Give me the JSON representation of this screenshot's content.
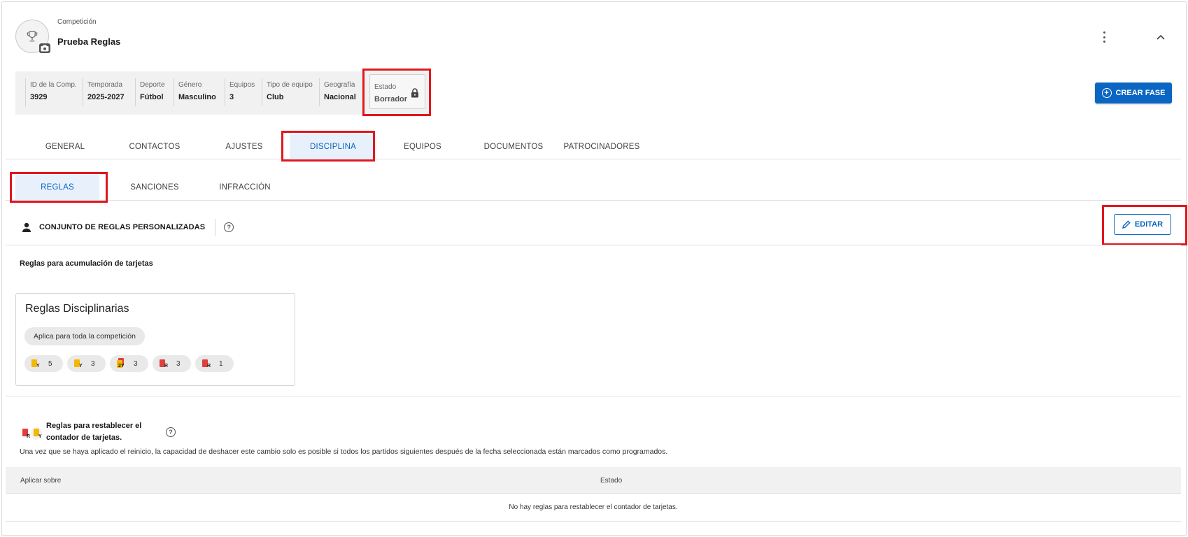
{
  "competition": {
    "label": "Competición",
    "name": "Prueba Reglas"
  },
  "info": [
    {
      "label": "ID de la Comp.",
      "value": "3929"
    },
    {
      "label": "Temporada",
      "value": "2025-2027"
    },
    {
      "label": "Deporte",
      "value": "Fútbol"
    },
    {
      "label": "Género",
      "value": "Masculino"
    },
    {
      "label": "Equipos",
      "value": "3"
    },
    {
      "label": "Tipo de equipo",
      "value": "Club"
    },
    {
      "label": "Geografía",
      "value": "Nacional"
    }
  ],
  "estado": {
    "label": "Estado",
    "value": "Borrador"
  },
  "actions": {
    "crear_fase": "CREAR FASE",
    "editar": "EDITAR"
  },
  "tabs": [
    "GENERAL",
    "CONTACTOS",
    "AJUSTES",
    "DISCIPLINA",
    "EQUIPOS",
    "DOCUMENTOS",
    "PATROCINADORES"
  ],
  "active_tab": "DISCIPLINA",
  "subtabs": [
    "REGLAS",
    "SANCIONES",
    "INFRACCIÓN"
  ],
  "active_subtab": "REGLAS",
  "ruleset": {
    "title": "CONJUNTO DE REGLAS PERSONALIZADAS"
  },
  "accumulation": {
    "heading": "Reglas para acumulación de tarjetas",
    "card_title": "Reglas Disciplinarias",
    "scope_chip": "Aplica para toda la competición",
    "cards": [
      {
        "type": "Y",
        "color": "#f5b800",
        "count": "5"
      },
      {
        "type": "Y",
        "color": "#f5b800",
        "count": "3"
      },
      {
        "type": "2Y",
        "color": "#f5b800",
        "count": "3"
      },
      {
        "type": "R",
        "color": "#e0403c",
        "count": "3"
      },
      {
        "type": "R",
        "color": "#e0403c",
        "count": "1"
      }
    ]
  },
  "reset": {
    "title": "Reglas para restablecer el contador de tarjetas.",
    "description": "Una vez que se haya aplicado el reinicio, la capacidad de deshacer este cambio solo es posible si todos los partidos siguientes después de la fecha seleccionada están marcados como programados.",
    "columns": [
      "Aplicar sobre",
      "Estado"
    ],
    "empty": "No hay reglas para restablecer el contador de tarjetas."
  },
  "colors": {
    "accent": "#0a66c2",
    "highlight": "#e0181e"
  }
}
